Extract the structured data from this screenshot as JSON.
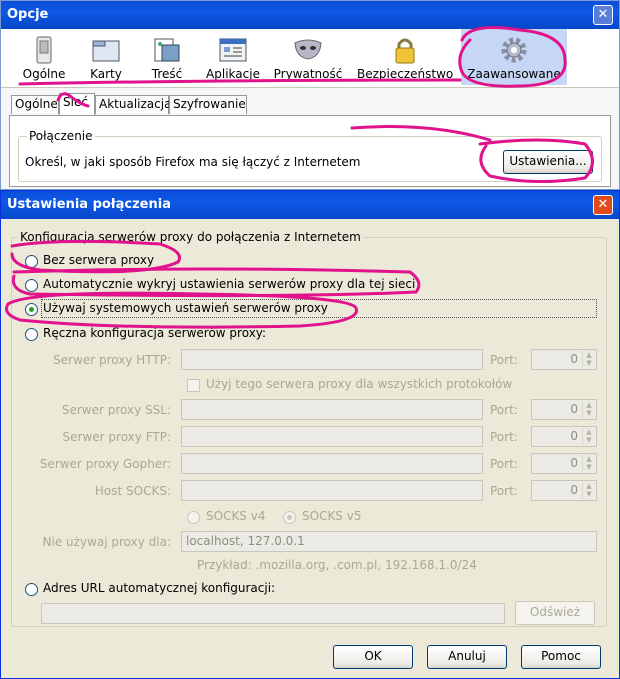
{
  "opcje": {
    "title": "Opcje",
    "close_glyph": "✕",
    "toolbar": [
      {
        "label": "Ogólne",
        "icon": "switch-icon"
      },
      {
        "label": "Karty",
        "icon": "tabs-icon"
      },
      {
        "label": "Treść",
        "icon": "content-icon"
      },
      {
        "label": "Aplikacje",
        "icon": "applications-icon"
      },
      {
        "label": "Prywatność",
        "icon": "mask-icon"
      },
      {
        "label": "Bezpieczeństwo",
        "icon": "padlock-icon"
      },
      {
        "label": "Zaawansowane",
        "icon": "gear-icon",
        "selected": true
      }
    ],
    "subtabs": [
      "Ogólne",
      "Sieć",
      "Aktualizacja",
      "Szyfrowanie"
    ],
    "active_subtab": "Sieć",
    "connection": {
      "legend": "Połączenie",
      "description": "Określ, w jaki sposób Firefox ma się łączyć z Internetem",
      "button": "Ustawienia..."
    }
  },
  "ustawienia": {
    "title": "Ustawienia połączenia",
    "close_glyph": "✕",
    "group_legend": "Konfiguracja serwerów proxy do połączenia z Internetem",
    "options": {
      "no_proxy": "Bez serwera proxy",
      "auto_detect": "Automatycznie wykryj ustawienia serwerów proxy dla tej sieci",
      "system_proxy": "Używaj systemowych ustawień serwerów proxy",
      "manual": "Ręczna konfiguracja serwerów proxy:",
      "auto_url": "Adres URL automatycznej konfiguracji:"
    },
    "selected_option": "system_proxy",
    "manual_fields": {
      "http_label": "Serwer proxy HTTP:",
      "use_for_all": "Użyj tego serwera proxy dla wszystkich protokołów",
      "ssl_label": "Serwer proxy SSL:",
      "ftp_label": "Serwer proxy FTP:",
      "gopher_label": "Serwer proxy Gopher:",
      "socks_label": "Host SOCKS:",
      "port_label": "Port:",
      "port_value": "0",
      "socks_v4": "SOCKS v4",
      "socks_v5": "SOCKS v5",
      "no_proxy_label": "Nie używaj proxy dla:",
      "no_proxy_value": "localhost, 127.0.0.1",
      "example": "Przykład: .mozilla.org, .com.pl, 192.168.1.0/24"
    },
    "reload_button": "Odśwież",
    "buttons": {
      "ok": "OK",
      "cancel": "Anuluj",
      "help": "Pomoc"
    }
  },
  "colors": {
    "annotation": "#e0128c",
    "xp_blue": "#0a4fd8",
    "selected_tab": "#c5d7f5"
  }
}
